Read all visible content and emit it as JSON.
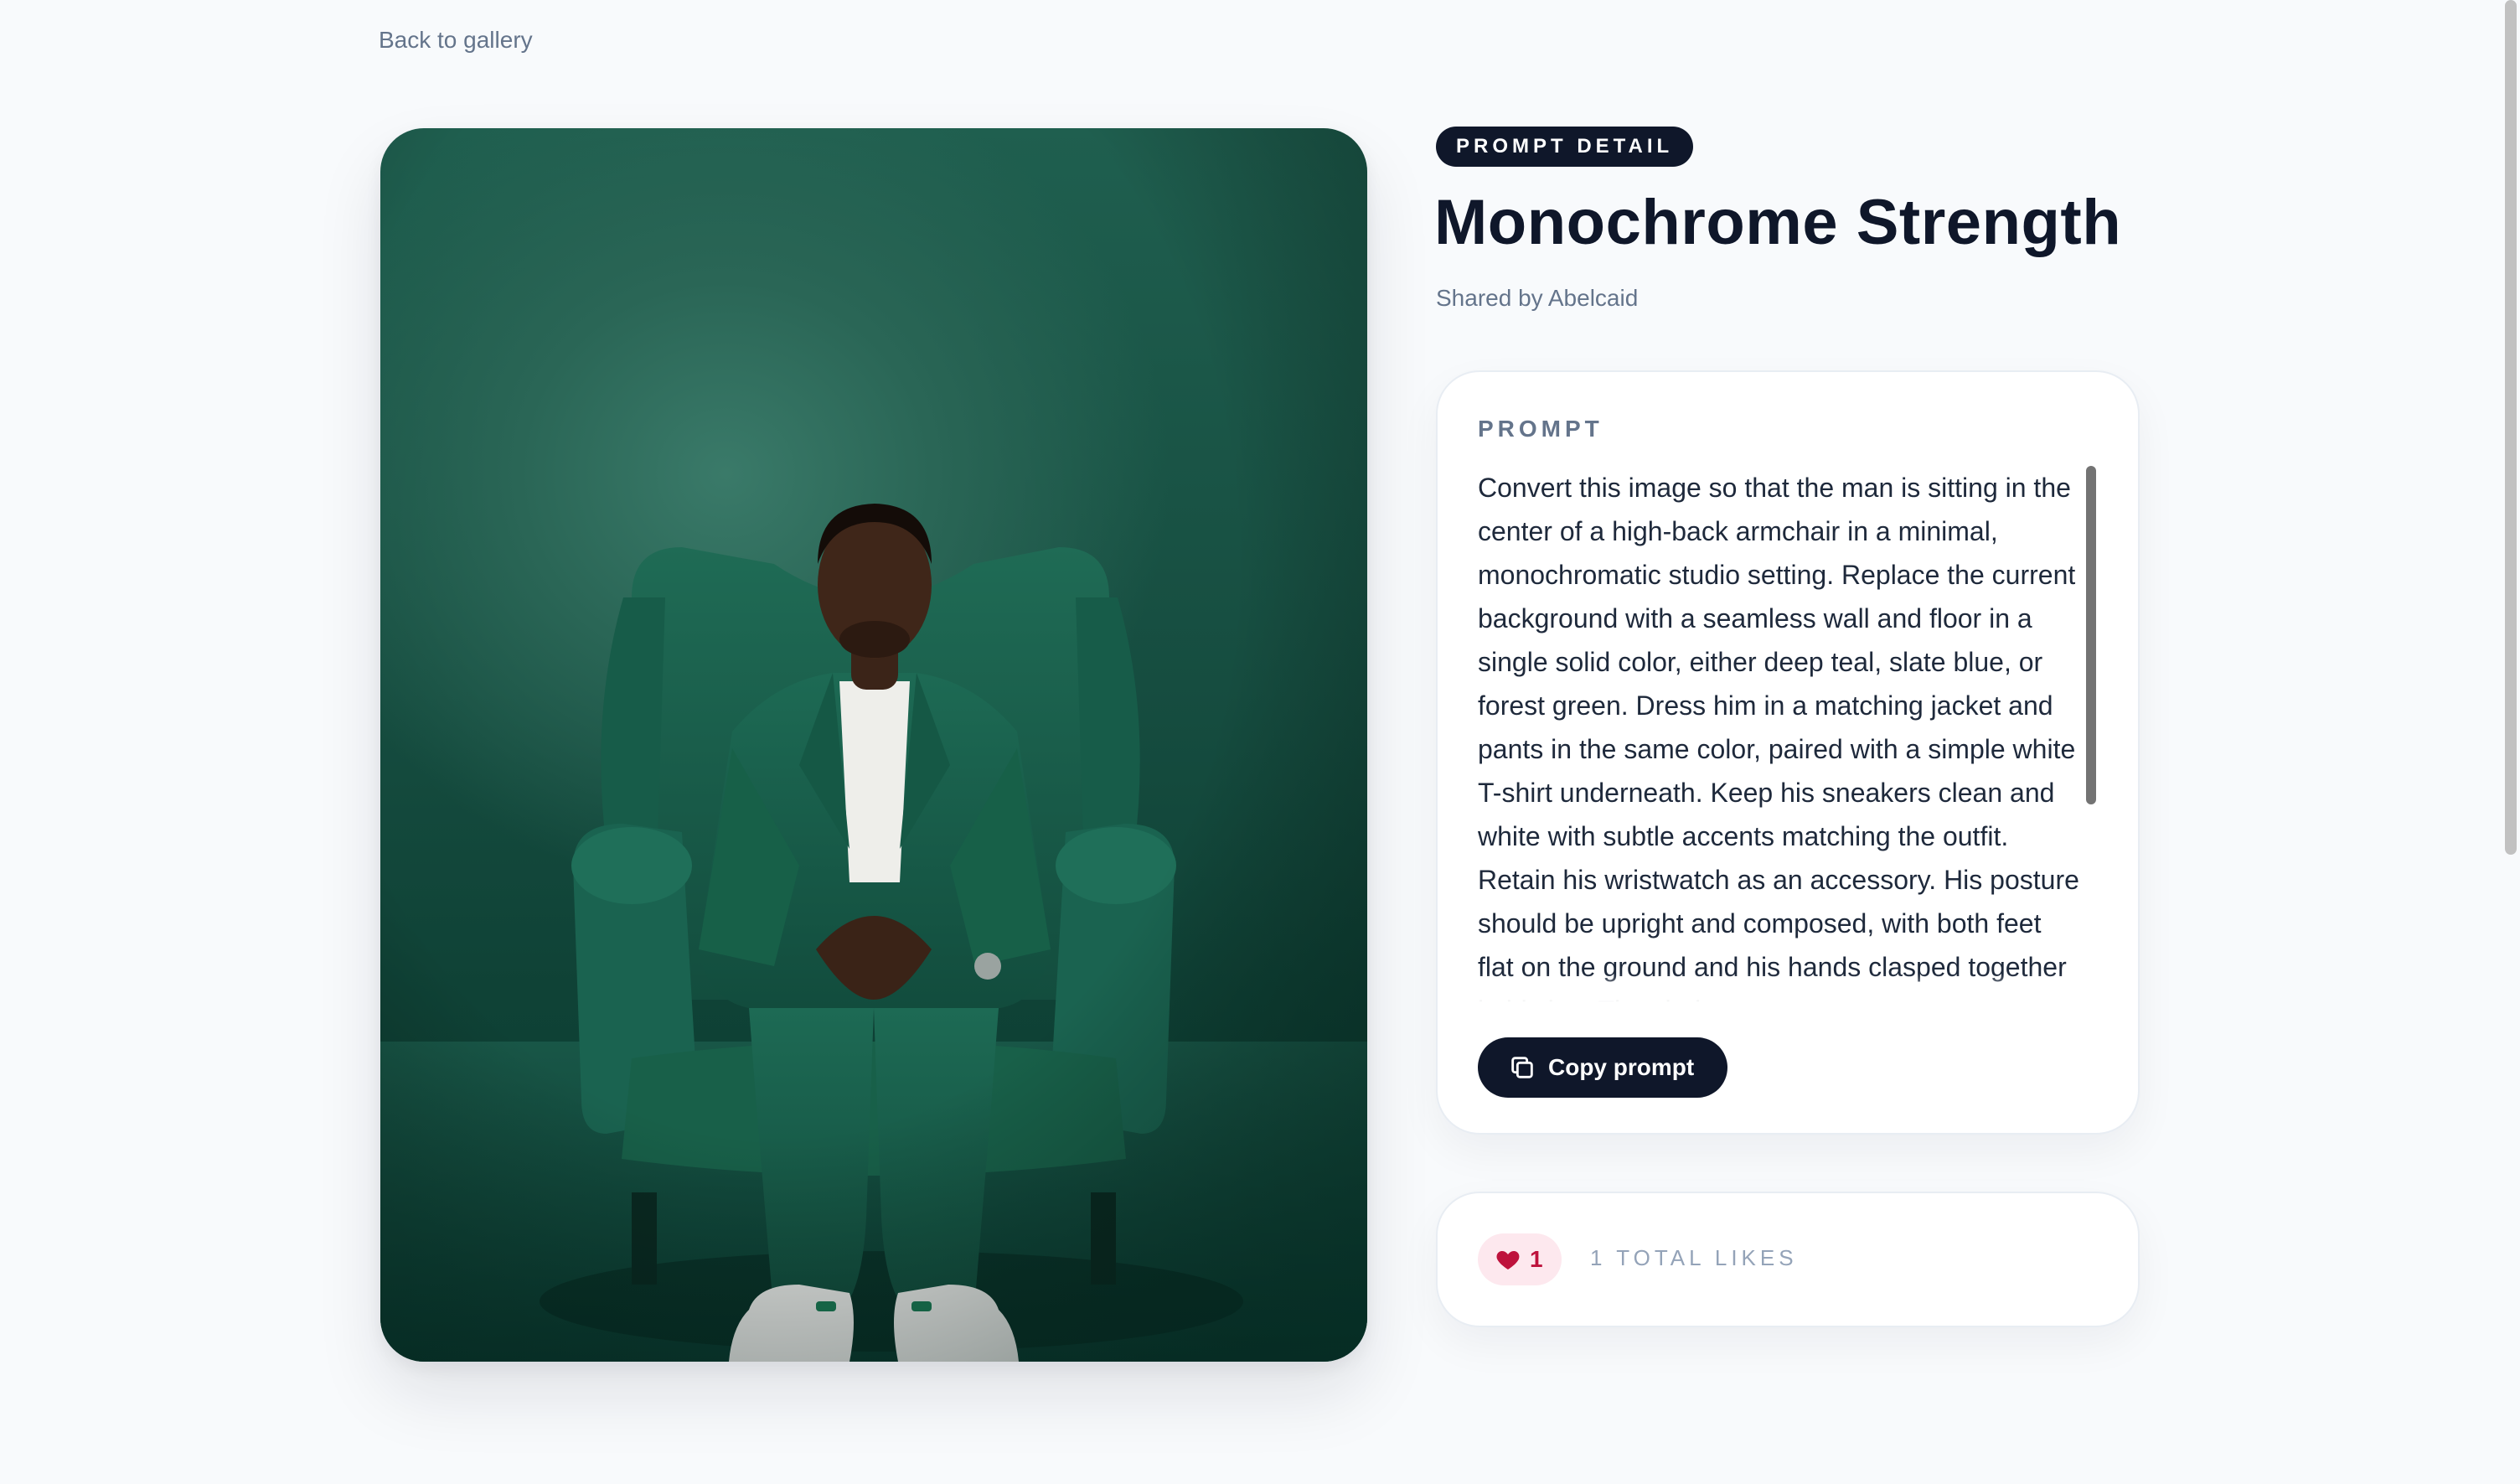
{
  "nav": {
    "back_label": "Back to gallery"
  },
  "image": {
    "alt": "Man in a green suit seated in a green armchair against a teal backdrop"
  },
  "detail": {
    "badge": "PROMPT DETAIL",
    "title": "Monochrome Strength",
    "shared_by": "Shared by Abelcaid"
  },
  "prompt": {
    "section_label": "PROMPT",
    "text": "Convert this image so that the man is sitting in the center of a high-back armchair in a minimal, monochromatic studio setting. Replace the current background with a seamless wall and floor in a single solid color, either deep teal, slate blue, or forest green. Dress him in a matching jacket and pants in the same color, paired with a simple white T-shirt underneath. Keep his sneakers clean and white with subtle accents matching the outfit. Retain his wristwatch as an accessory. His posture should be upright and composed, with both feet flat on the ground and his hands clasped together in his lap. The chair",
    "copy_label": "Copy prompt",
    "copy_icon": "copy-icon",
    "scroll_position": 0
  },
  "likes": {
    "count": "1",
    "total_label": "1 TOTAL LIKES",
    "icon": "heart-icon"
  },
  "colors": {
    "dark": "#0f172a",
    "muted": "#64748b",
    "like_bg": "#fde8ee",
    "like_fg": "#be123c",
    "photo_teal": "#1f5f4f"
  }
}
